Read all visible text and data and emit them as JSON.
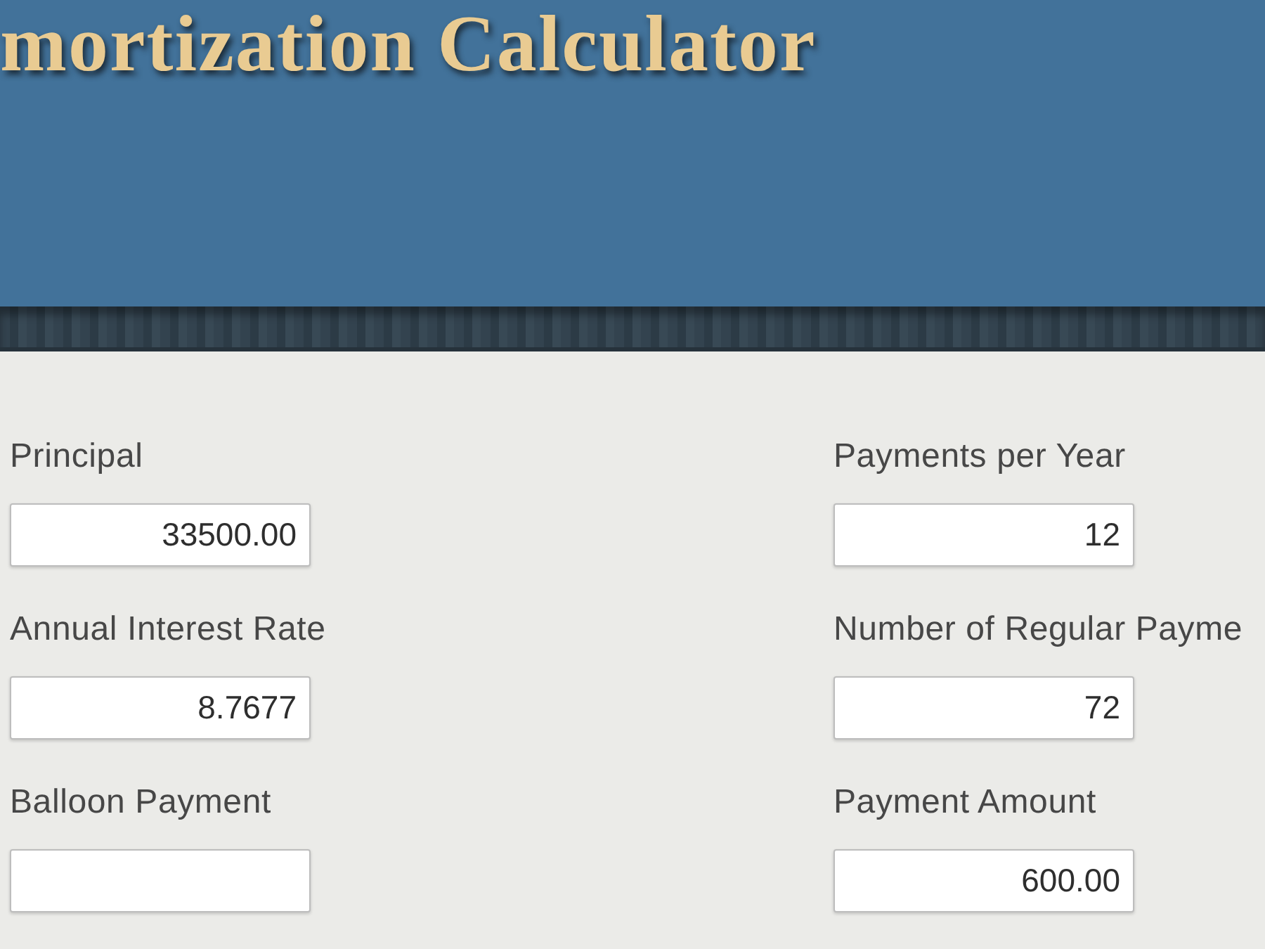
{
  "header": {
    "title": "mortization Calculator"
  },
  "form": {
    "columns": [
      {
        "fields": [
          {
            "label": "Principal",
            "value": "33500.00"
          },
          {
            "label": "Annual Interest Rate",
            "value": "8.7677"
          },
          {
            "label": "Balloon Payment"
          }
        ]
      },
      {
        "fields": [
          {
            "label": "Payments per Year",
            "value": "12"
          },
          {
            "label": "Number of Regular Payme",
            "value": "72"
          },
          {
            "label": "Payment Amount",
            "value": "600.00"
          }
        ]
      }
    ]
  }
}
